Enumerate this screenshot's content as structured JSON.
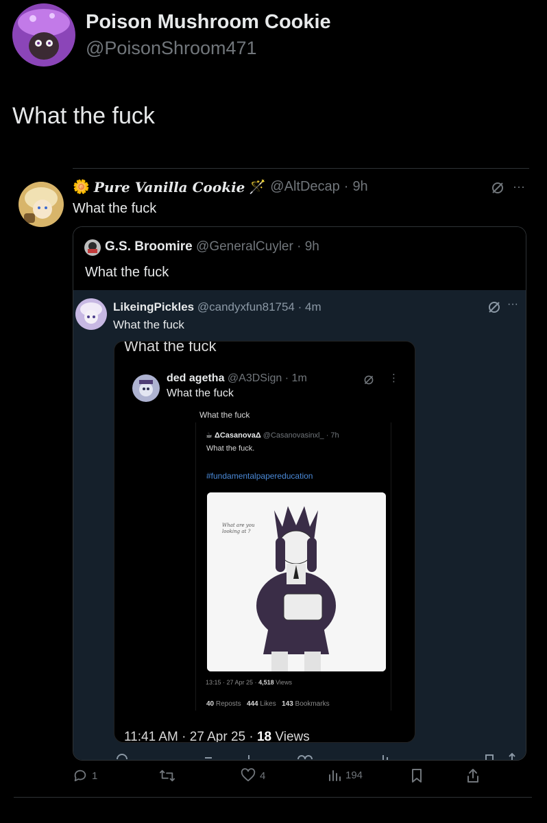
{
  "main_post": {
    "display_name": "Poison Mushroom Cookie",
    "handle": "@PoisonShroom471",
    "text": "What the fuck"
  },
  "quote1": {
    "display_name": "Pure Vanilla Cookie",
    "name_prefix_emoji": "🌼",
    "name_suffix_emoji": "🪄",
    "handle": "@AltDecap",
    "time": "9h",
    "text": "What the fuck"
  },
  "quote2": {
    "display_name": "G.S. Broomire",
    "handle": "@GeneralCuyler",
    "time": "9h",
    "text": "What the fuck"
  },
  "quote3": {
    "display_name": "LikeingPickles",
    "handle": "@candyxfun81754",
    "time": "4m",
    "text": "What the fuck"
  },
  "screenshot": {
    "cut_text": "What the fuck",
    "inner_post": {
      "display_name": "ded agetha",
      "handle": "@A3DSign",
      "time": "1m",
      "text": "What the fuck"
    },
    "faded_text": "What the fuck",
    "casanova_post": {
      "display_name": "ΔCasanovaΔ",
      "handle": "@Casanovasinxl_",
      "time": "7h",
      "text": "What the fuck.",
      "hashtag": "#fundamentalpapereducation",
      "art_caption": "What are you looking at ?",
      "meta": "13:15 · 27 Apr 25 · ",
      "views_count": "4,518",
      "views_label": " Views",
      "reposts_count": "40",
      "reposts_label": " Reposts",
      "likes_count": "444",
      "likes_label": " Likes",
      "bookmarks_count": "143",
      "bookmarks_label": " Bookmarks"
    },
    "footer_time": "11:41 AM · 27 Apr 25 · ",
    "footer_views_count": "18",
    "footer_views_label": " Views"
  },
  "actions": {
    "reply_count": "1",
    "repost_count": "",
    "like_count": "4",
    "views_count": "194"
  },
  "colors": {
    "background": "#000000",
    "card_dark": "#15202b",
    "muted": "#71767b",
    "link": "#4b8ad8"
  },
  "icons": [
    "reply-icon",
    "repost-icon",
    "like-icon",
    "views-icon",
    "bookmark-icon",
    "share-icon",
    "grok-icon",
    "more-icon"
  ]
}
